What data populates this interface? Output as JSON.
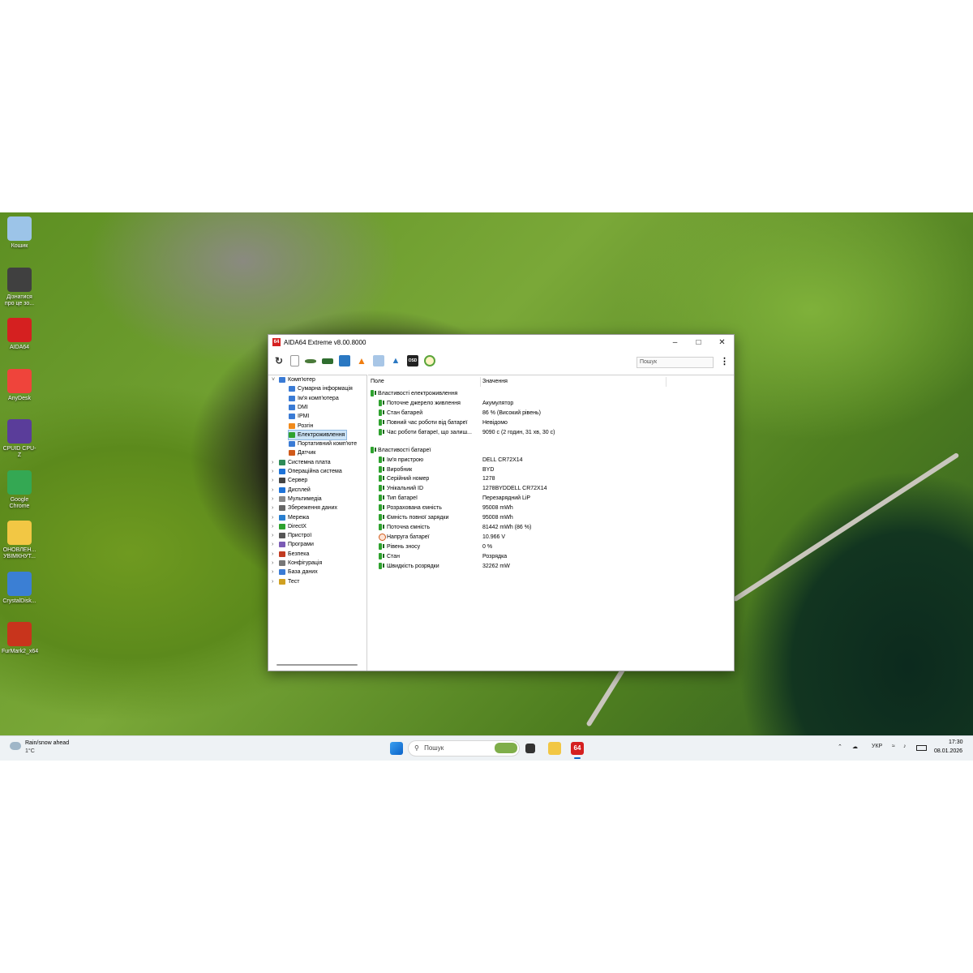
{
  "desktop": {
    "icons": [
      {
        "label": "Кошик",
        "icon": "recycle-bin-icon",
        "color": "#9cc4e8"
      },
      {
        "label": "Дізнатися про це зо...",
        "icon": "learn-icon",
        "color": "#404040"
      },
      {
        "label": "AIDA64",
        "icon": "aida64-icon",
        "color": "#d52020"
      },
      {
        "label": "AnyDesk",
        "icon": "anydesk-icon",
        "color": "#ef443b"
      },
      {
        "label": "CPUID CPU-Z",
        "icon": "cpuz-icon",
        "color": "#5a3d9a"
      },
      {
        "label": "Google Chrome",
        "icon": "chrome-icon",
        "color": "#34a853"
      },
      {
        "label": "ОНОВЛЕН... УВІМКНУТ...",
        "icon": "folder-icon",
        "color": "#f2c744"
      },
      {
        "label": "CrystalDisk...",
        "icon": "crystaldisk-icon",
        "color": "#3b7fd4"
      },
      {
        "label": "FurMark2_x64",
        "icon": "furmark-icon",
        "color": "#c8341c"
      }
    ]
  },
  "window": {
    "title": "AIDA64 Extreme v8.00.8000",
    "search_placeholder": "Пошук",
    "toolbar": [
      "refresh-icon",
      "report-icon",
      "motherboard-icon",
      "memory-icon",
      "network-icon",
      "flame-icon",
      "benchmark-icon",
      "user-icon",
      "osd-icon",
      "gauge-icon"
    ],
    "osd_label": "OSD",
    "tree": [
      {
        "label": "Комп'ютер",
        "level": 0,
        "expanded": true,
        "color": "#3a7bd5"
      },
      {
        "label": "Сумарна інформація",
        "level": 1,
        "color": "#3a7bd5"
      },
      {
        "label": "Ім'я комп'ютера",
        "level": 1,
        "color": "#3a7bd5"
      },
      {
        "label": "DMI",
        "level": 1,
        "color": "#3a7bd5"
      },
      {
        "label": "IPMI",
        "level": 1,
        "color": "#3a7bd5"
      },
      {
        "label": "Розгін",
        "level": 1,
        "color": "#f08a1c"
      },
      {
        "label": "Електроживлення",
        "level": 1,
        "selected": true,
        "color": "#2ea22e"
      },
      {
        "label": "Портативний комп'юте",
        "level": 1,
        "color": "#3a7bd5"
      },
      {
        "label": "Датчик",
        "level": 1,
        "color": "#d05a1a"
      },
      {
        "label": "Системна плата",
        "level": 0,
        "color": "#2e8b57"
      },
      {
        "label": "Операційна система",
        "level": 0,
        "color": "#1e73d8"
      },
      {
        "label": "Сервер",
        "level": 0,
        "color": "#444444"
      },
      {
        "label": "Дисплей",
        "level": 0,
        "color": "#1e73d8"
      },
      {
        "label": "Мультимедіа",
        "level": 0,
        "color": "#888888"
      },
      {
        "label": "Збереження даних",
        "level": 0,
        "color": "#666666"
      },
      {
        "label": "Мережа",
        "level": 0,
        "color": "#2a7fd0"
      },
      {
        "label": "DirectX",
        "level": 0,
        "color": "#2ea22e"
      },
      {
        "label": "Пристрої",
        "level": 0,
        "color": "#555555"
      },
      {
        "label": "Програми",
        "level": 0,
        "color": "#7b5bb5"
      },
      {
        "label": "Безпека",
        "level": 0,
        "color": "#c23b22"
      },
      {
        "label": "Конфігурація",
        "level": 0,
        "color": "#777777"
      },
      {
        "label": "База даних",
        "level": 0,
        "color": "#3a7bd5"
      },
      {
        "label": "Тест",
        "level": 0,
        "color": "#d0a020"
      }
    ],
    "columns": {
      "field": "Поле",
      "value": "Значення"
    },
    "sections": [
      {
        "title": "Властивості електроживлення",
        "rows": [
          {
            "field": "Поточне джерело живлення",
            "value": "Акумулятор",
            "icon": "battery-icon"
          },
          {
            "field": "Стан батарей",
            "value": "86 % (Високий рівень)",
            "icon": "battery-icon"
          },
          {
            "field": "Повний час роботи від батареї",
            "value": "Невідомо",
            "icon": "battery-icon"
          },
          {
            "field": "Час роботи батареї, що залиш...",
            "value": "9090 с (2 годин, 31 хв, 30 с)",
            "icon": "battery-icon"
          }
        ]
      },
      {
        "title": "Властивості батареї",
        "rows": [
          {
            "field": "Ім'я пристрою",
            "value": "DELL CR72X14",
            "icon": "battery-icon"
          },
          {
            "field": "Виробник",
            "value": "BYD",
            "icon": "battery-icon"
          },
          {
            "field": "Серійний номер",
            "value": "1278",
            "icon": "battery-icon"
          },
          {
            "field": "Унікальний ID",
            "value": "1278BYDDELL CR72X14",
            "icon": "battery-icon"
          },
          {
            "field": "Тип батареї",
            "value": "Перезарядний LiP",
            "icon": "battery-icon"
          },
          {
            "field": "Розрахована ємність",
            "value": "95008 mWh",
            "icon": "battery-icon"
          },
          {
            "field": "Ємність повної зарядки",
            "value": "95008 mWh",
            "icon": "battery-icon"
          },
          {
            "field": "Поточна ємність",
            "value": "81442 mWh  (86 %)",
            "icon": "battery-icon"
          },
          {
            "field": "Напруга батареї",
            "value": "10.966 V",
            "icon": "voltage-icon"
          },
          {
            "field": "Рівень зносу",
            "value": "0 %",
            "icon": "battery-icon"
          },
          {
            "field": "Стан",
            "value": "Розрядка",
            "icon": "battery-icon"
          },
          {
            "field": "Швидкість розрядки",
            "value": "32262 mW",
            "icon": "battery-icon"
          }
        ]
      }
    ]
  },
  "taskbar": {
    "weather": {
      "text": "Rain/snow ahead",
      "temp": "1°C"
    },
    "search_label": "Пошук",
    "language": "УКР",
    "time": "17:30",
    "date": "08.01.2026",
    "aida_label": "64"
  }
}
